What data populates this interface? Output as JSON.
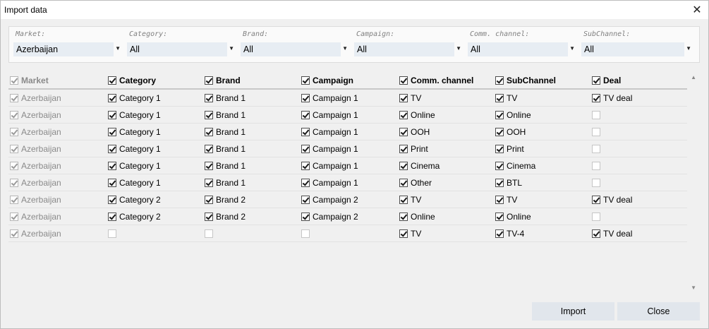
{
  "window": {
    "title": "Import data",
    "close_glyph": "✕"
  },
  "filters": [
    {
      "label": "Market:",
      "value": "Azerbaijan"
    },
    {
      "label": "Category:",
      "value": "All"
    },
    {
      "label": "Brand:",
      "value": "All"
    },
    {
      "label": "Campaign:",
      "value": "All"
    },
    {
      "label": "Comm. channel:",
      "value": "All"
    },
    {
      "label": "SubChannel:",
      "value": "All"
    }
  ],
  "columns": [
    {
      "key": "market",
      "label": "Market",
      "checked": true,
      "disabled": true
    },
    {
      "key": "category",
      "label": "Category",
      "checked": true,
      "disabled": false
    },
    {
      "key": "brand",
      "label": "Brand",
      "checked": true,
      "disabled": false
    },
    {
      "key": "campaign",
      "label": "Campaign",
      "checked": true,
      "disabled": false
    },
    {
      "key": "channel",
      "label": "Comm. channel",
      "checked": true,
      "disabled": false
    },
    {
      "key": "subchannel",
      "label": "SubChannel",
      "checked": true,
      "disabled": false
    },
    {
      "key": "deal",
      "label": "Deal",
      "checked": true,
      "disabled": false
    }
  ],
  "rows": [
    {
      "market": "Azerbaijan",
      "category": "Category 1",
      "brand": "Brand 1",
      "campaign": "Campaign 1",
      "channel": "TV",
      "subchannel": "TV",
      "deal": "TV deal"
    },
    {
      "market": "Azerbaijan",
      "category": "Category 1",
      "brand": "Brand 1",
      "campaign": "Campaign 1",
      "channel": "Online",
      "subchannel": "Online",
      "deal": ""
    },
    {
      "market": "Azerbaijan",
      "category": "Category 1",
      "brand": "Brand 1",
      "campaign": "Campaign 1",
      "channel": "OOH",
      "subchannel": "OOH",
      "deal": ""
    },
    {
      "market": "Azerbaijan",
      "category": "Category 1",
      "brand": "Brand 1",
      "campaign": "Campaign 1",
      "channel": "Print",
      "subchannel": "Print",
      "deal": ""
    },
    {
      "market": "Azerbaijan",
      "category": "Category 1",
      "brand": "Brand 1",
      "campaign": "Campaign 1",
      "channel": "Cinema",
      "subchannel": "Cinema",
      "deal": ""
    },
    {
      "market": "Azerbaijan",
      "category": "Category 1",
      "brand": "Brand 1",
      "campaign": "Campaign 1",
      "channel": "Other",
      "subchannel": "BTL",
      "deal": ""
    },
    {
      "market": "Azerbaijan",
      "category": "Category 2",
      "brand": "Brand 2",
      "campaign": "Campaign 2",
      "channel": "TV",
      "subchannel": "TV",
      "deal": "TV deal"
    },
    {
      "market": "Azerbaijan",
      "category": "Category 2",
      "brand": "Brand 2",
      "campaign": "Campaign 2",
      "channel": "Online",
      "subchannel": "Online",
      "deal": ""
    },
    {
      "market": "Azerbaijan",
      "category": "",
      "brand": "",
      "campaign": "",
      "channel": "TV",
      "subchannel": "TV-4",
      "deal": "TV deal"
    }
  ],
  "buttons": {
    "import": "Import",
    "close": "Close"
  },
  "icons": {
    "close": "close-icon",
    "dropdown": "chevron-down-icon",
    "scroll_up": "scroll-up-icon",
    "scroll_down": "scroll-down-icon"
  },
  "colors": {
    "filter_bg": "#e7edf3",
    "button_bg": "#e1e6ec",
    "disabled_text": "#8a8a8a"
  }
}
